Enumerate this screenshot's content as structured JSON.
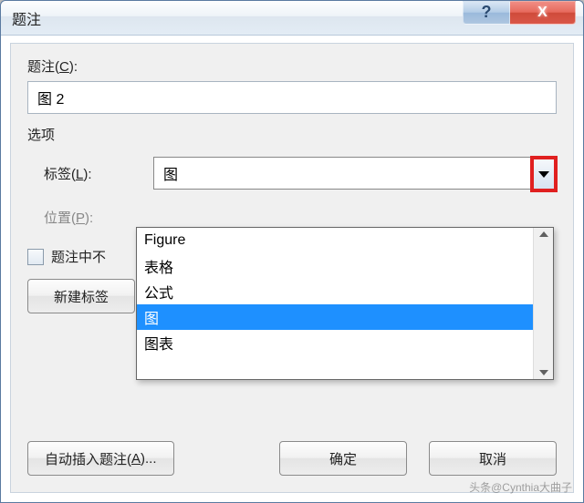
{
  "titlebar": {
    "title": "题注",
    "help_symbol": "?",
    "close_symbol": "X"
  },
  "caption": {
    "label_prefix": "题注(",
    "label_hotkey": "C",
    "label_suffix": "):",
    "value": "图 2"
  },
  "options": {
    "heading": "选项",
    "label_field": {
      "prefix": "标签(",
      "hotkey": "L",
      "suffix": "):",
      "value": "图"
    },
    "position_field": {
      "prefix": "位置(",
      "hotkey": "P",
      "suffix": "):"
    }
  },
  "exclude_checkbox": {
    "label": "题注中不"
  },
  "dropdown": {
    "items": [
      "Figure",
      "表格",
      "公式",
      "图",
      "图表"
    ],
    "selected_index": 3
  },
  "buttons": {
    "new_label": "新建标签",
    "auto_prefix": "自动插入题注(",
    "auto_hotkey": "A",
    "auto_suffix": ")...",
    "ok": "确定",
    "cancel": "取消"
  },
  "watermark": "头条@Cynthia大曲子"
}
